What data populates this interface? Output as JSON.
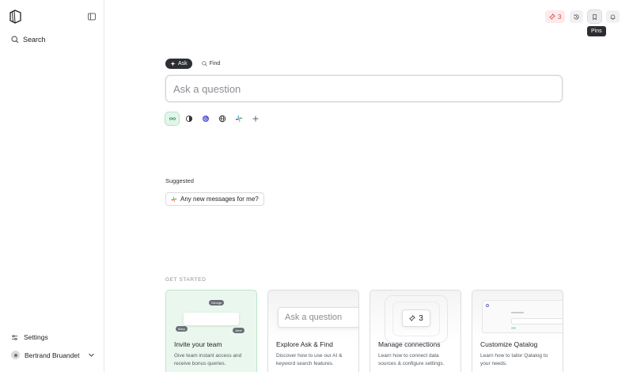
{
  "sidebar": {
    "search_label": "Search",
    "settings_label": "Settings",
    "user_name": "Bertrand Bruandet"
  },
  "topbar": {
    "pins_count": "3",
    "tooltip": "Pins"
  },
  "main": {
    "modes": [
      {
        "label": "Ask",
        "active": true
      },
      {
        "label": "Find",
        "active": false
      }
    ],
    "ask_placeholder": "Ask a question",
    "sources": [
      "all-sources-icon",
      "openai-icon",
      "linear-icon",
      "web-icon",
      "slack-icon",
      "add-icon"
    ],
    "suggested_label": "Suggested",
    "suggestion": "Any new messages for me?",
    "get_started_label": "GET STARTED",
    "cards": [
      {
        "title": "Invite your team",
        "desc": "Give team instant access and receive bonus queries.",
        "illus_names": [
          "George",
          "Mary",
          "Jane"
        ]
      },
      {
        "title": "Explore Ask & Find",
        "desc": "Discover how to use our AI & keyword search features.",
        "illus_placeholder": "Ask a question"
      },
      {
        "title": "Manage connections",
        "desc": "Learn how to connect data sources & configure settings.",
        "illus_count": "3"
      },
      {
        "title": "Customize Qatalog",
        "desc": "Learn how to tailor Qatalog to your needs."
      }
    ]
  },
  "colors": {
    "accent_green": "#e3f5ea",
    "pin_red": "#d94b4b",
    "dark": "#2c2f33"
  }
}
